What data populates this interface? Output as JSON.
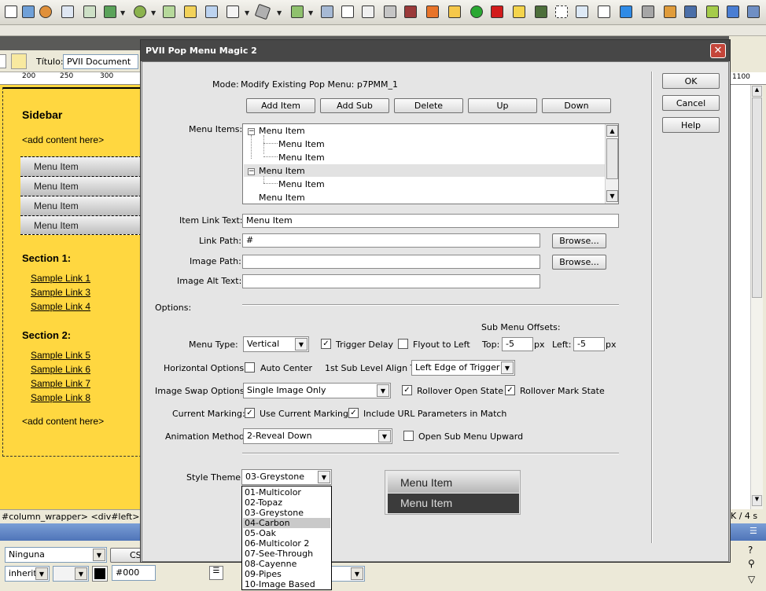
{
  "dialog": {
    "title": "PVII Pop Menu Magic 2",
    "close_glyph": "✕",
    "mode_label": "Mode:",
    "mode_value": "Modify Existing Pop Menu: p7PMM_1",
    "buttons": {
      "add_item": "Add Item",
      "add_sub": "Add Sub",
      "delete": "Delete",
      "up": "Up",
      "down": "Down"
    },
    "side_buttons": {
      "ok": "OK",
      "cancel": "Cancel",
      "help": "Help"
    },
    "menu_items_label": "Menu Items:",
    "tree": [
      {
        "text": "Menu Item",
        "level": 0,
        "expander": "⊟"
      },
      {
        "text": "Menu Item",
        "level": 1
      },
      {
        "text": "Menu Item",
        "level": 1
      },
      {
        "text": "Menu Item",
        "level": 0,
        "expander": "⊟",
        "selected": true
      },
      {
        "text": "Menu Item",
        "level": 1
      },
      {
        "text": "Menu Item",
        "level": 0
      }
    ],
    "item_link_text": {
      "label": "Item Link Text:",
      "value": "Menu Item"
    },
    "link_path": {
      "label": "Link Path:",
      "value": "#",
      "browse": "Browse..."
    },
    "image_path": {
      "label": "Image Path:",
      "value": "",
      "browse": "Browse..."
    },
    "image_alt": {
      "label": "Image Alt Text:",
      "value": ""
    },
    "options_label": "Options:",
    "sub_offsets": {
      "label": "Sub Menu Offsets:",
      "top_label": "Top:",
      "top_value": "-5",
      "left_label": "Left:",
      "left_value": "-5",
      "unit": "px"
    },
    "menu_type": {
      "label": "Menu Type:",
      "value": "Vertical"
    },
    "trigger_delay": {
      "label": "Trigger Delay",
      "checked": true
    },
    "flyout_left": {
      "label": "Flyout to Left",
      "checked": false
    },
    "horizontal_options": {
      "label": "Horizontal Options:"
    },
    "auto_center": {
      "label": "Auto Center",
      "checked": false
    },
    "first_sub_align": {
      "label": "1st Sub Level Align To:",
      "value": "Left Edge of Trigger"
    },
    "image_swap": {
      "label": "Image Swap Options:",
      "value": "Single Image Only"
    },
    "rollover_open": {
      "label": "Rollover Open State",
      "checked": true
    },
    "rollover_mark": {
      "label": "Rollover Mark State",
      "checked": true
    },
    "current_marking": {
      "label": "Current Marking:"
    },
    "use_current_marking": {
      "label": "Use Current Marking",
      "checked": true
    },
    "include_url": {
      "label": "Include URL Parameters in Match",
      "checked": true
    },
    "animation": {
      "label": "Animation Method:",
      "value": "2-Reveal Down"
    },
    "open_upward": {
      "label": "Open Sub Menu Upward",
      "checked": false
    },
    "style_theme": {
      "label": "Style Theme:",
      "value": "03-Greystone",
      "options": [
        "01-Multicolor",
        "02-Topaz",
        "03-Greystone",
        "04-Carbon",
        "05-Oak",
        "06-Multicolor 2",
        "07-See-Through",
        "08-Cayenne",
        "09-Pipes",
        "10-Image Based"
      ],
      "highlighted_index": 3
    },
    "preview": {
      "item1": "Menu Item",
      "item2": "Menu Item"
    }
  },
  "document": {
    "title_label": "Título:",
    "title_value": "PVII Document",
    "ruler_ticks": [
      "200",
      "250",
      "300"
    ],
    "right_ruler_tick": "1100",
    "sidebar_heading": "Sidebar",
    "add_content_1": "<add content here>",
    "menu_items": [
      "Menu Item",
      "Menu Item",
      "Menu Item",
      "Menu Item"
    ],
    "section1": {
      "heading": "Section 1:",
      "links": [
        "Sample Link 1",
        "Sample Link 3",
        "Sample Link 4"
      ]
    },
    "section2": {
      "heading": "Section 2:",
      "links": [
        "Sample Link 5",
        "Sample Link 6",
        "Sample Link 7",
        "Sample Link 8"
      ]
    },
    "add_content_2": "<add content here>",
    "status_path": "#column_wrapper> <div#left> <div.c",
    "status_right": "K / 4 s"
  },
  "properties": {
    "format_value": "Ninguna",
    "css_button": "CS",
    "size_value": "inherit",
    "color_value": "#000"
  }
}
